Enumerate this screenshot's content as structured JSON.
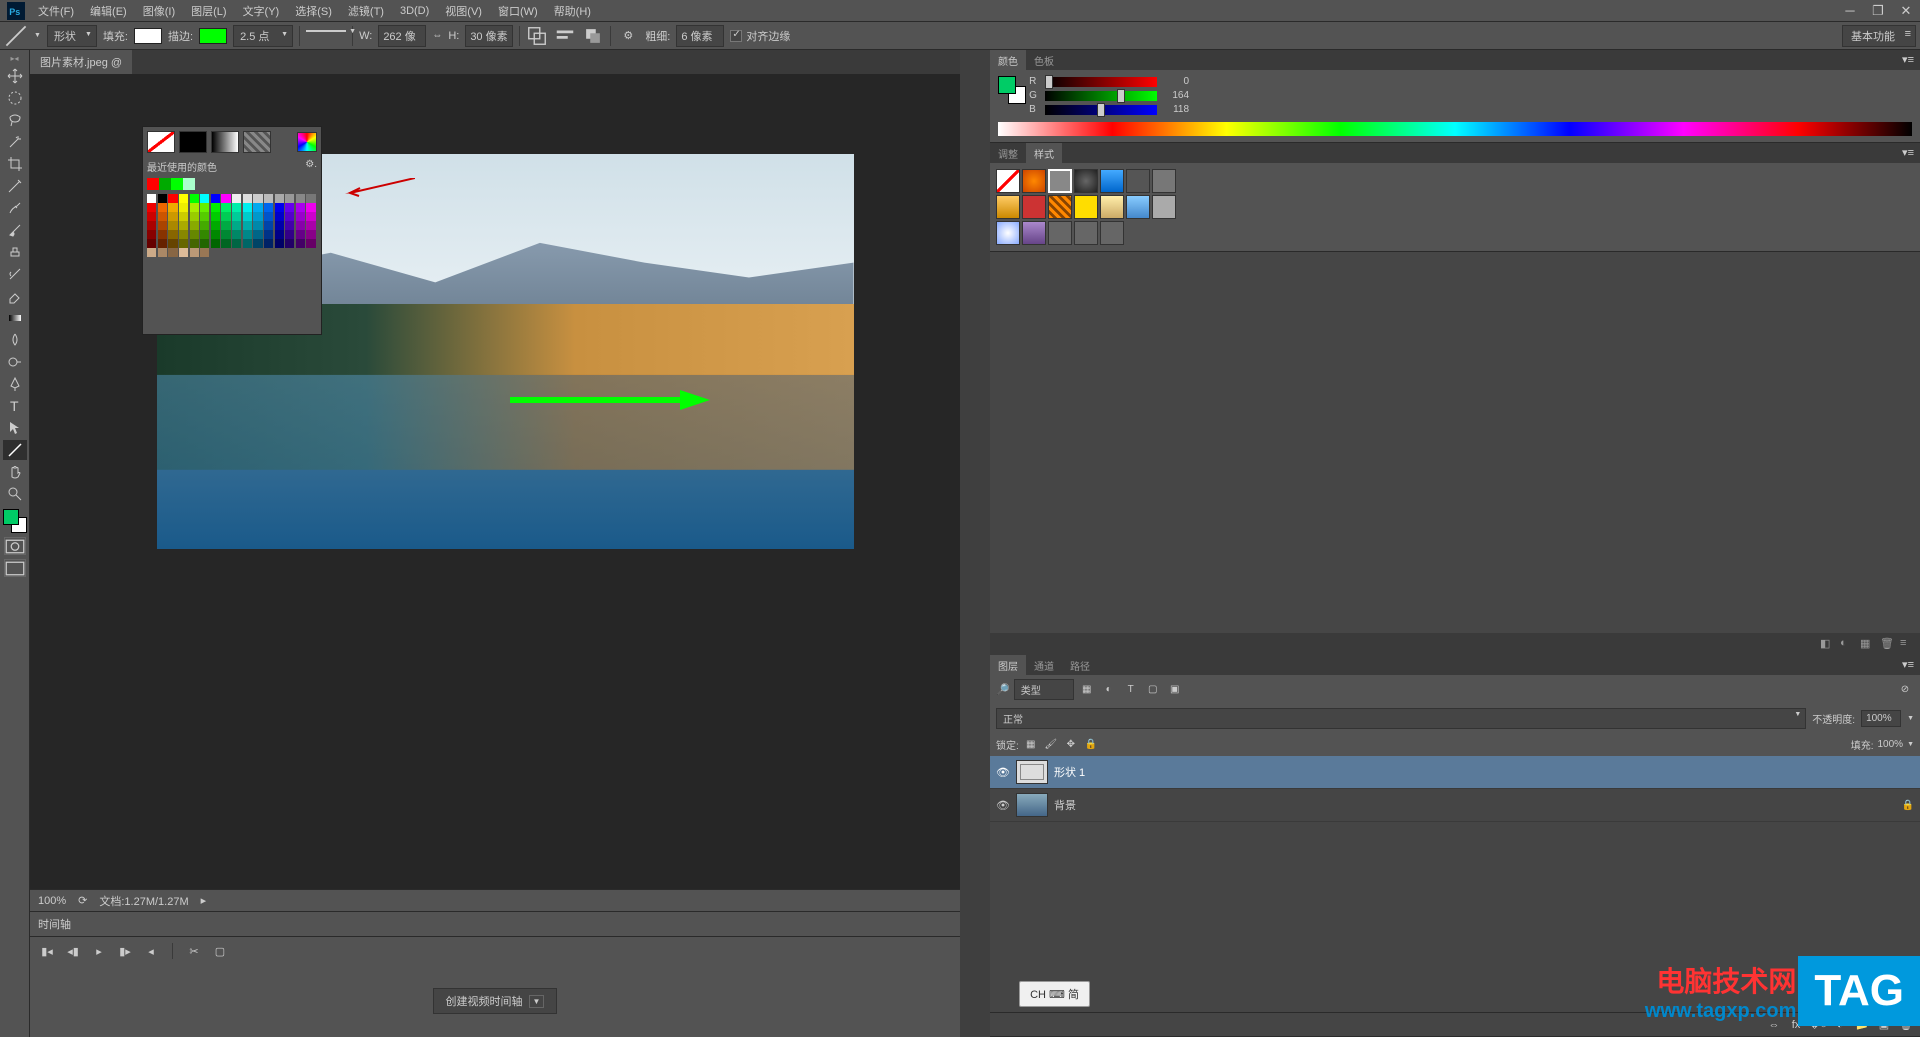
{
  "menubar": {
    "items": [
      "文件(F)",
      "编辑(E)",
      "图像(I)",
      "图层(L)",
      "文字(Y)",
      "选择(S)",
      "滤镜(T)",
      "3D(D)",
      "视图(V)",
      "窗口(W)",
      "帮助(H)"
    ]
  },
  "options": {
    "shape_mode": "形状",
    "fill_label": "填充:",
    "fill_color": "#ffffff",
    "stroke_label": "描边:",
    "stroke_color": "#00ff00",
    "stroke_width": "2.5 点",
    "w_label": "W:",
    "w_value": "262 像",
    "h_label": "H:",
    "h_value": "30 像素",
    "thickness_label": "粗细:",
    "thickness_value": "6 像素",
    "align_edges": "对齐边缘",
    "workspace": "基本功能"
  },
  "document": {
    "tab": "图片素材.jpeg @",
    "zoom": "100%",
    "doc_info": "文档:1.27M/1.27M"
  },
  "color_popup": {
    "recent_label": "最近使用的颜色",
    "recent": [
      "#ff0000",
      "#00aa00",
      "#00ff00",
      "#aaffcc"
    ]
  },
  "timeline": {
    "tab": "时间轴",
    "create_button": "创建视频时间轴"
  },
  "ime": "CH ⌨ 简",
  "right_panels": {
    "color": {
      "tabs": [
        "颜色",
        "色板"
      ],
      "fg_color": "#00cc66",
      "r": 0,
      "g": 164,
      "b": 118
    },
    "adjust_styles": {
      "tabs": [
        "调整",
        "样式"
      ]
    },
    "layers": {
      "tabs": [
        "图层",
        "通道",
        "路径"
      ],
      "filter_type": "类型",
      "blend_mode": "正常",
      "opacity_label": "不透明度:",
      "opacity": "100%",
      "lock_label": "锁定:",
      "fill_label": "填充:",
      "fill": "100%",
      "items": [
        {
          "name": "形状 1",
          "selected": true,
          "locked": false
        },
        {
          "name": "背景",
          "selected": false,
          "locked": true
        }
      ]
    }
  },
  "watermark": {
    "cn": "电脑技术网",
    "url": "www.tagxp.com",
    "tag": "TAG"
  },
  "palette_colors": [
    "#ffffff",
    "#000000",
    "#ff0000",
    "#ffff00",
    "#00ff00",
    "#00ffff",
    "#0000ff",
    "#ff00ff",
    "#eeeeee",
    "#dddddd",
    "#cccccc",
    "#bbbbbb",
    "#aaaaaa",
    "#999999",
    "#888888",
    "#777777",
    "#ee0000",
    "#ee6600",
    "#eeaa00",
    "#eeee00",
    "#aaee00",
    "#66ee00",
    "#00ee00",
    "#00ee66",
    "#00eeaa",
    "#00eeee",
    "#00aaee",
    "#0066ee",
    "#0000ee",
    "#6600ee",
    "#aa00ee",
    "#ee00ee",
    "#cc0000",
    "#cc5500",
    "#cc9900",
    "#cccc00",
    "#99cc00",
    "#55cc00",
    "#00cc00",
    "#00cc55",
    "#00cc99",
    "#00cccc",
    "#0099cc",
    "#0055cc",
    "#0000cc",
    "#5500cc",
    "#9900cc",
    "#cc00cc",
    "#aa0000",
    "#aa4400",
    "#aa8800",
    "#aaaa00",
    "#88aa00",
    "#44aa00",
    "#00aa00",
    "#00aa44",
    "#00aa88",
    "#00aaaa",
    "#0088aa",
    "#0044aa",
    "#0000aa",
    "#4400aa",
    "#8800aa",
    "#aa00aa",
    "#880000",
    "#883300",
    "#886600",
    "#888800",
    "#668800",
    "#338800",
    "#008800",
    "#008833",
    "#008866",
    "#008888",
    "#006688",
    "#003388",
    "#000088",
    "#330088",
    "#660088",
    "#880088",
    "#660000",
    "#662200",
    "#664400",
    "#666600",
    "#446600",
    "#226600",
    "#006600",
    "#006622",
    "#006644",
    "#006666",
    "#004466",
    "#002266",
    "#000066",
    "#220066",
    "#440066",
    "#660066",
    "#ccaa88",
    "#aa8866",
    "#886644",
    "#ddbb99",
    "#bb9977",
    "#997755"
  ]
}
